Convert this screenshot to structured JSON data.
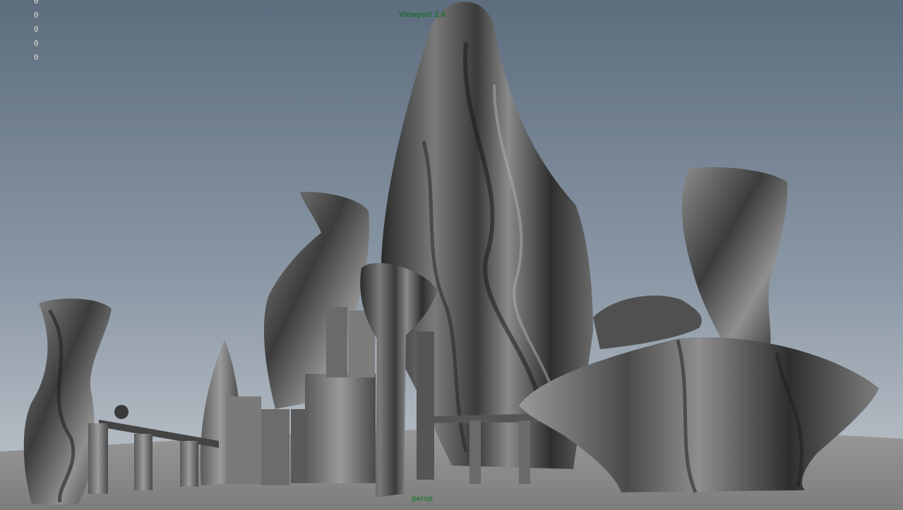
{
  "viewport": {
    "renderer_label": "Viewport 2.0",
    "camera_label": "persp",
    "hud_counters": [
      "0",
      "0",
      "0",
      "0",
      "0"
    ],
    "background_top_color": "#5f6f81",
    "background_bottom_color": "#b9c1c8",
    "ground_color": "#8a8a8a",
    "model_color": "#4f4f4f"
  }
}
